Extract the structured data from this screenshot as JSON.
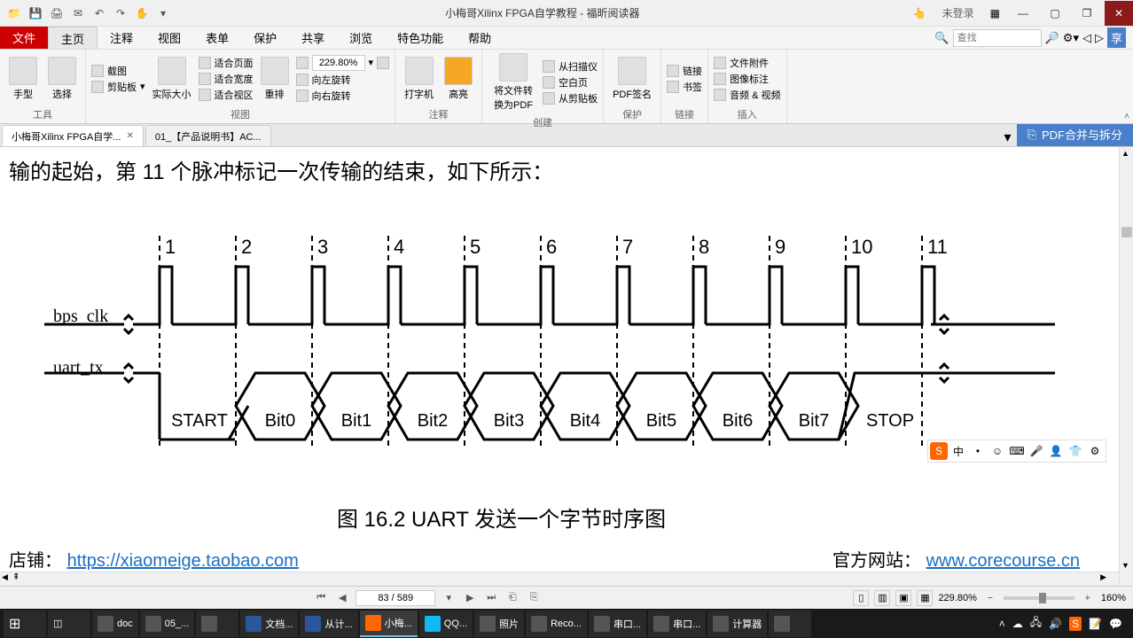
{
  "window": {
    "title": "小梅哥Xilinx FPGA自学教程 - 福昕阅读器",
    "login": "未登录"
  },
  "menu": {
    "file": "文件",
    "tabs": [
      "主页",
      "注释",
      "视图",
      "表单",
      "保护",
      "共享",
      "浏览",
      "特色功能",
      "帮助"
    ],
    "search_placeholder": "查找"
  },
  "ribbon": {
    "tools": {
      "hand": "手型",
      "select": "选择",
      "label": "工具"
    },
    "screenshot": "截图",
    "clipboard": "剪贴板",
    "actual_size": "实际大小",
    "rearrange": "重排",
    "fit_page": "适合页面",
    "fit_width": "适合宽度",
    "fit_view": "适合视区",
    "view_label": "视图",
    "zoom_value": "229.80%",
    "rotate_left": "向左旋转",
    "rotate_right": "向右旋转",
    "typewriter": "打字机",
    "highlight": "高亮",
    "annotate_label": "注释",
    "convert_pdf": "将文件转换为PDF",
    "from_scanner": "从扫描仪",
    "blank_page": "空白页",
    "from_clipboard": "从剪贴板",
    "create_label": "创建",
    "pdf_sign": "PDF签名",
    "protect_label": "保护",
    "link": "链接",
    "bookmark": "书签",
    "link_label": "链接",
    "attachment": "文件附件",
    "image_annot": "图像标注",
    "audio_video": "音频 & 视频",
    "insert_label": "插入",
    "share": "享"
  },
  "tabs": {
    "tab1": "小梅哥Xilinx FPGA自学...",
    "tab2": "01_【产品说明书】AC...",
    "pdf_merge": "PDF合并与拆分"
  },
  "document": {
    "text_line": "输的起始，第 11 个脉冲标记一次传输的结束，如下所示：",
    "signal1": "bps_clk",
    "signal2": "uart_tx",
    "pulse_labels": [
      "1",
      "2",
      "3",
      "4",
      "5",
      "6",
      "7",
      "8",
      "9",
      "10",
      "11"
    ],
    "bits": [
      "START",
      "Bit0",
      "Bit1",
      "Bit2",
      "Bit3",
      "Bit4",
      "Bit5",
      "Bit6",
      "Bit7",
      "STOP"
    ],
    "caption": "图 16.2 UART 发送一个字节时序图",
    "shop_prefix": "店铺：",
    "shop_url": "https://xiaomeige.taobao.com",
    "official_prefix": "官方网站：",
    "official_url": "www.corecourse.cn"
  },
  "status": {
    "page": "83 / 589",
    "zoom": "229.80%",
    "zoom2": "160%"
  },
  "ime": {
    "items": [
      "中",
      "•",
      "☺",
      "⌨",
      "🎤",
      "👤",
      "👕",
      "⚙"
    ]
  },
  "taskbar": {
    "items": [
      "doc",
      "05_...",
      "",
      "文档...",
      "从计...",
      "小梅...",
      "QQ...",
      "照片",
      "Reco...",
      "串口...",
      "串口...",
      "计算器"
    ]
  }
}
